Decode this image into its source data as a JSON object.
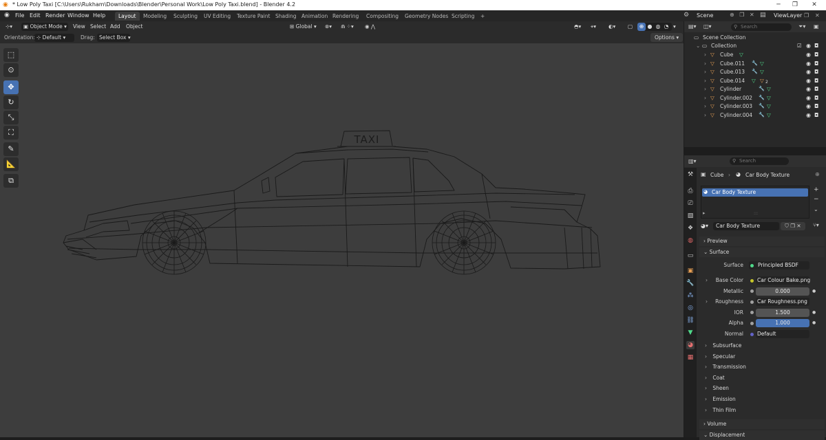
{
  "window": {
    "title": "* Low Poly Taxi [C:\\Users\\Rukham\\Downloads\\Blender\\Personal Work\\Low Poly Taxi.blend] - Blender 4.2",
    "minimize": "─",
    "maximize": "❐",
    "close": "✕"
  },
  "menu": [
    "File",
    "Edit",
    "Render",
    "Window",
    "Help"
  ],
  "workspaces": [
    "Layout",
    "Modeling",
    "Sculpting",
    "UV Editing",
    "Texture Paint",
    "Shading",
    "Animation",
    "Rendering",
    "Compositing",
    "Geometry Nodes",
    "Scripting",
    "+"
  ],
  "active_workspace": "Layout",
  "scene": {
    "label": "Scene",
    "view_layer": "ViewLayer"
  },
  "viewport_header": {
    "mode": "Object Mode",
    "view": "View",
    "select": "Select",
    "add": "Add",
    "object": "Object",
    "transform": "Global"
  },
  "tool_header": {
    "orientation_label": "Orientation:",
    "orientation_value": "Default",
    "drag_label": "Drag:",
    "drag_value": "Select Box",
    "options": "Options"
  },
  "outliner": {
    "search_placeholder": "Search",
    "root": "Scene Collection",
    "collection": "Collection",
    "items": [
      "Cube",
      "Cube.011",
      "Cube.013",
      "Cube.014",
      "Cylinder",
      "Cylinder.002",
      "Cylinder.003",
      "Cylinder.004"
    ],
    "badge_count": "2"
  },
  "properties": {
    "search_placeholder": "Search",
    "breadcrumb_object": "Cube",
    "breadcrumb_material": "Car Body Texture",
    "material_slot": "Car Body Texture",
    "material_name": "Car Body Texture",
    "sections": {
      "preview": "Preview",
      "surface": "Surface"
    },
    "surface_label": "Surface",
    "surface_value": "Principled BSDF",
    "fields": [
      {
        "label": "Base Color",
        "value": "Car Colour Bake.png",
        "kind": "texture"
      },
      {
        "label": "Metallic",
        "value": "0.000",
        "kind": "number"
      },
      {
        "label": "Roughness",
        "value": "Car Roughness.png",
        "kind": "texture"
      },
      {
        "label": "IOR",
        "value": "1.500",
        "kind": "number"
      },
      {
        "label": "Alpha",
        "value": "1.000",
        "kind": "number-full"
      },
      {
        "label": "Normal",
        "value": "Default",
        "kind": "text"
      }
    ],
    "subsections": [
      "Subsurface",
      "Specular",
      "Transmission",
      "Coat",
      "Sheen",
      "Emission",
      "Thin Film"
    ],
    "bottom_sections": [
      "Volume",
      "Displacement"
    ]
  },
  "model": {
    "sign_text": "TAXI"
  },
  "colors": {
    "accent_blue": "#4772b3",
    "mesh_orange": "#e8a055",
    "modifier_blue": "#8ab4f0",
    "data_green": "#4fd98a"
  }
}
